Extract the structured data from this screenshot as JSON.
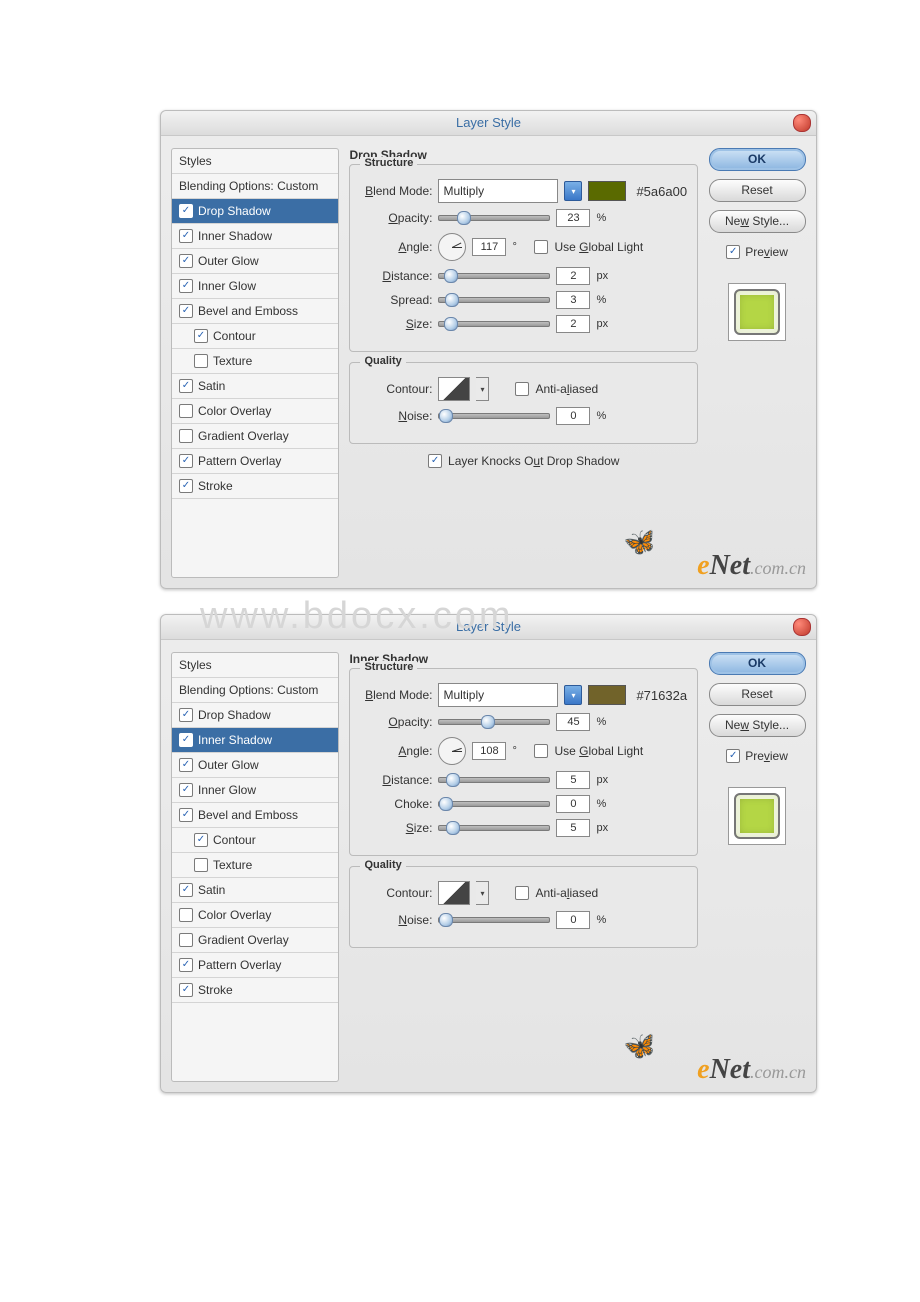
{
  "watermark": "www.bdocx.com",
  "dialogs": [
    {
      "title": "Layer Style",
      "styles_header": "Styles",
      "blending": "Blending Options: Custom",
      "selected": "Drop Shadow",
      "items": [
        {
          "label": "Drop Shadow",
          "checked": true,
          "selected": true
        },
        {
          "label": "Inner Shadow",
          "checked": true
        },
        {
          "label": "Outer Glow",
          "checked": true
        },
        {
          "label": "Inner Glow",
          "checked": true
        },
        {
          "label": "Bevel and Emboss",
          "checked": true
        },
        {
          "label": "Contour",
          "checked": true,
          "sub": true
        },
        {
          "label": "Texture",
          "checked": false,
          "sub": true
        },
        {
          "label": "Satin",
          "checked": true
        },
        {
          "label": "Color Overlay",
          "checked": false
        },
        {
          "label": "Gradient Overlay",
          "checked": false
        },
        {
          "label": "Pattern Overlay",
          "checked": true
        },
        {
          "label": "Stroke",
          "checked": true
        }
      ],
      "panel": "Drop Shadow",
      "grp_structure": "Structure",
      "blend_mode_lbl": "Blend Mode:",
      "blend_mode_val": "Multiply",
      "color_hex": "#5a6a00",
      "swatch": "#5a6a00",
      "opacity_lbl": "Opacity:",
      "opacity": "23",
      "opacity_u": "%",
      "opacity_pos": "16%",
      "angle_lbl": "Angle:",
      "angle": "117",
      "angle_u": "°",
      "angle_rot": "-27deg",
      "global_lbl": "Use Global Light",
      "global": false,
      "r1_lbl": "Distance:",
      "r1": "2",
      "r1_u": "px",
      "r1_pos": "4%",
      "r2_lbl": "Spread:",
      "r2": "3",
      "r2_u": "%",
      "r2_pos": "5%",
      "r3_lbl": "Size:",
      "r3": "2",
      "r3_u": "px",
      "r3_pos": "4%",
      "grp_quality": "Quality",
      "contour_lbl": "Contour:",
      "aa_lbl": "Anti-aliased",
      "aa": false,
      "noise_lbl": "Noise:",
      "noise": "0",
      "noise_u": "%",
      "noise_pos": "0%",
      "knock_lbl": "Layer Knocks Out Drop Shadow",
      "knock": true,
      "btn_ok": "OK",
      "btn_reset": "Reset",
      "btn_new": "New Style...",
      "preview_lbl": "Preview",
      "preview": true,
      "thumb_bg": "#b4d645"
    },
    {
      "title": "Layer Style",
      "styles_header": "Styles",
      "blending": "Blending Options: Custom",
      "selected": "Inner Shadow",
      "items": [
        {
          "label": "Drop Shadow",
          "checked": true
        },
        {
          "label": "Inner Shadow",
          "checked": true,
          "selected": true
        },
        {
          "label": "Outer Glow",
          "checked": true
        },
        {
          "label": "Inner Glow",
          "checked": true
        },
        {
          "label": "Bevel and Emboss",
          "checked": true
        },
        {
          "label": "Contour",
          "checked": true,
          "sub": true
        },
        {
          "label": "Texture",
          "checked": false,
          "sub": true
        },
        {
          "label": "Satin",
          "checked": true
        },
        {
          "label": "Color Overlay",
          "checked": false
        },
        {
          "label": "Gradient Overlay",
          "checked": false
        },
        {
          "label": "Pattern Overlay",
          "checked": true
        },
        {
          "label": "Stroke",
          "checked": true
        }
      ],
      "panel": "Inner Shadow",
      "grp_structure": "Structure",
      "blend_mode_lbl": "Blend Mode:",
      "blend_mode_val": "Multiply",
      "color_hex": "#71632a",
      "swatch": "#71632a",
      "opacity_lbl": "Opacity:",
      "opacity": "45",
      "opacity_u": "%",
      "opacity_pos": "38%",
      "angle_lbl": "Angle:",
      "angle": "108",
      "angle_u": "°",
      "angle_rot": "-18deg",
      "global_lbl": "Use Global Light",
      "global": false,
      "r1_lbl": "Distance:",
      "r1": "5",
      "r1_u": "px",
      "r1_pos": "6%",
      "r2_lbl": "Choke:",
      "r2": "0",
      "r2_u": "%",
      "r2_pos": "0%",
      "r3_lbl": "Size:",
      "r3": "5",
      "r3_u": "px",
      "r3_pos": "6%",
      "grp_quality": "Quality",
      "contour_lbl": "Contour:",
      "aa_lbl": "Anti-aliased",
      "aa": false,
      "noise_lbl": "Noise:",
      "noise": "0",
      "noise_u": "%",
      "noise_pos": "0%",
      "knock_lbl": "",
      "knock": null,
      "btn_ok": "OK",
      "btn_reset": "Reset",
      "btn_new": "New Style...",
      "preview_lbl": "Preview",
      "preview": true,
      "thumb_bg": "#b4d645"
    }
  ],
  "logo": {
    "e": "e",
    "net": "Net",
    "dom": ".com.cn"
  }
}
